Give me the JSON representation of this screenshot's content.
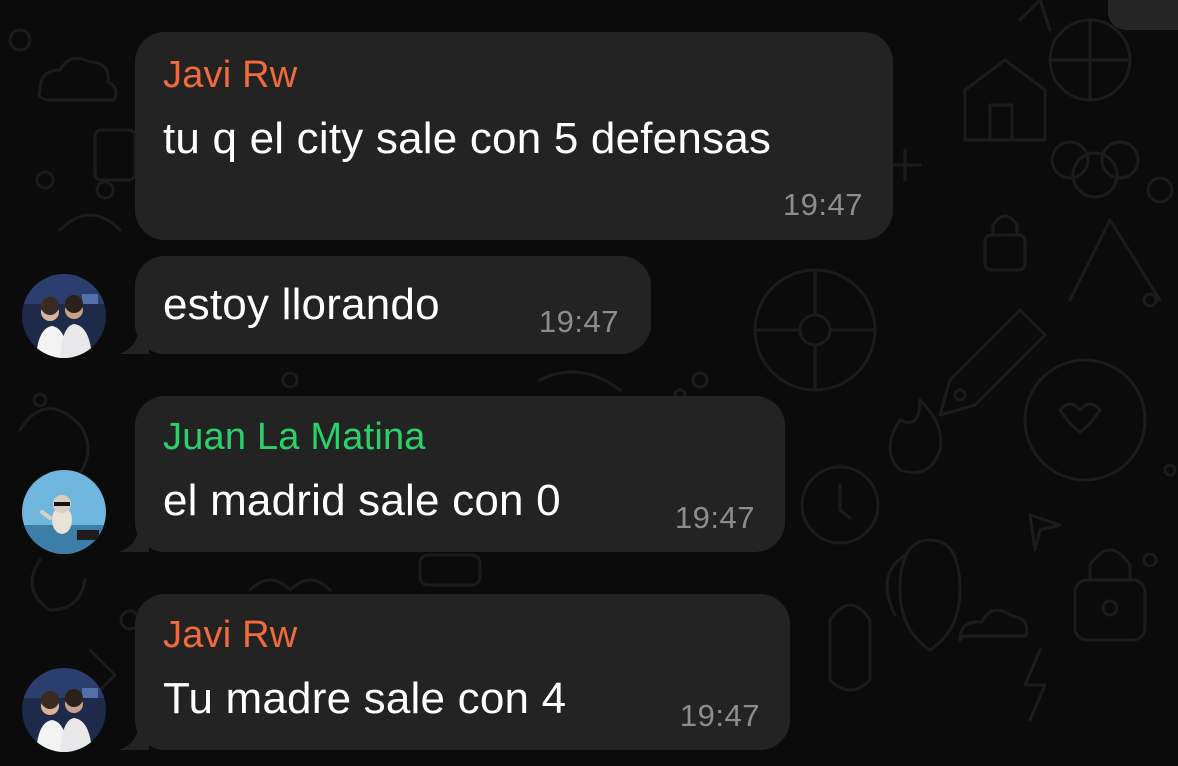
{
  "colors": {
    "background": "#0b0b0b",
    "bubble": "#232323",
    "text": "#ffffff",
    "timestamp": "#8d8d8d",
    "sender_orange": "#f26b3a",
    "sender_green": "#2bd16a"
  },
  "messages": [
    {
      "sender": "Javi Rw",
      "text": "tu q el city sale con 5 defensas",
      "time": "19:47"
    },
    {
      "sender": "",
      "text": "estoy llorando",
      "time": "19:47"
    },
    {
      "sender": "Juan La Matina",
      "text": "el madrid sale con 0",
      "time": "19:47"
    },
    {
      "sender": "Javi Rw",
      "text": "Tu madre sale con 4",
      "time": "19:47"
    }
  ],
  "avatars": {
    "javi": "group-photo-avatar",
    "juan": "figure-on-blue-avatar"
  }
}
